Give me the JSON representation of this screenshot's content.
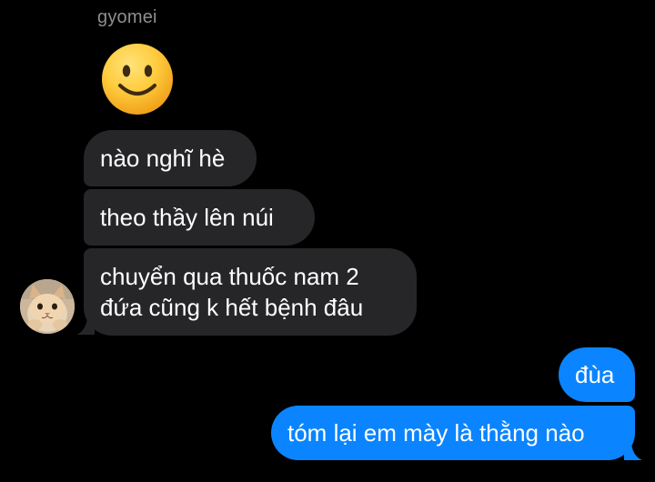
{
  "conversation": {
    "sender_name": "gyomei",
    "reaction_emoji": "slightly-smiling-face",
    "incoming_messages": [
      {
        "text": "nào nghĩ hè"
      },
      {
        "text": "theo thầy lên núi"
      },
      {
        "lines": [
          "chuyển qua thuốc nam 2",
          "đứa cũng k hết bệnh đâu"
        ]
      }
    ],
    "outgoing_messages": [
      {
        "text": "đùa"
      },
      {
        "text": "tóm lại em mày là thằng nào"
      }
    ],
    "avatar": "cat-avatar"
  },
  "colors": {
    "background": "#000000",
    "incoming_bubble": "#262628",
    "outgoing_bubble": "#0a84ff",
    "sender_name": "#8e8e93"
  }
}
